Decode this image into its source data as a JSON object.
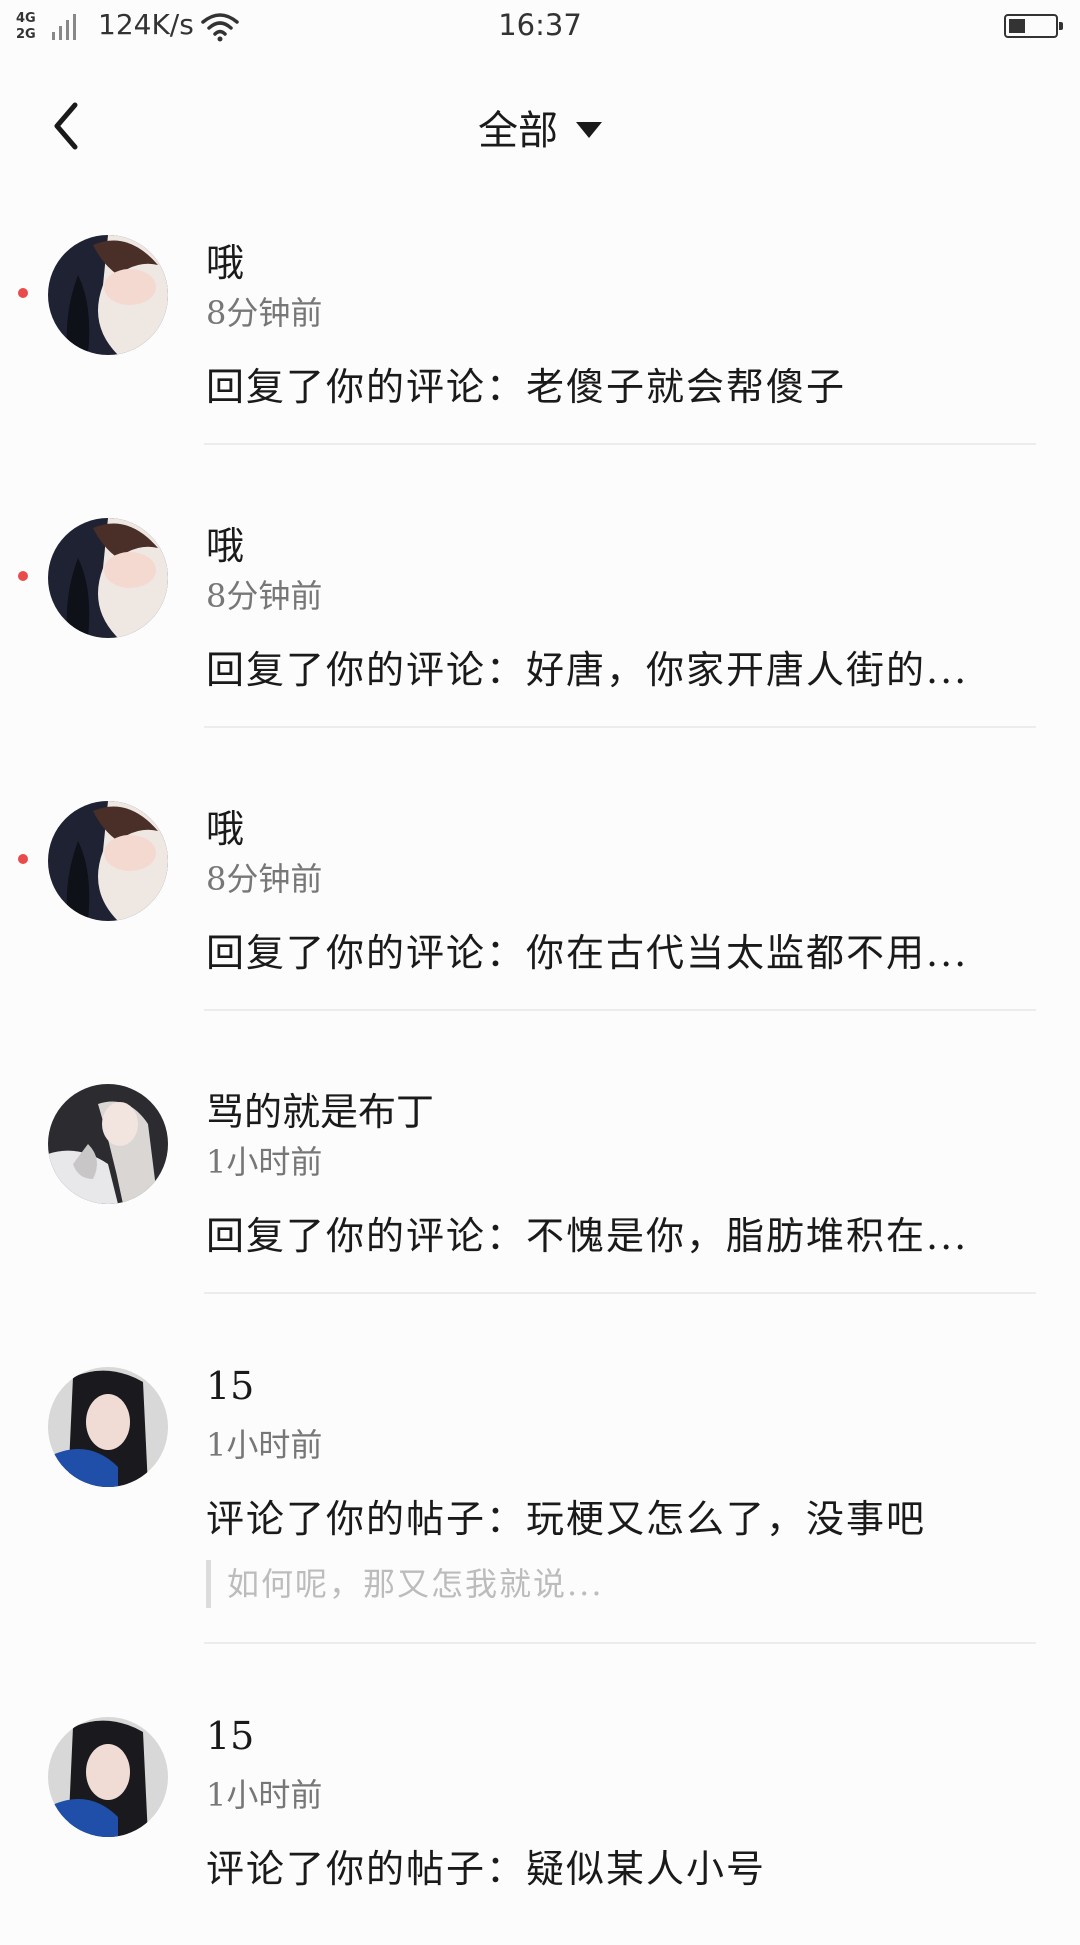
{
  "status_bar": {
    "network_top": "4G",
    "network_bottom": "2G",
    "speed": "124K/s",
    "time": "16:37"
  },
  "header": {
    "title": "全部"
  },
  "notifications": [
    {
      "user": "哦",
      "time": "8分钟前",
      "text": "回复了你的评论：老傻子就会帮傻子",
      "unread": true,
      "avatar": "avatar-girl-1"
    },
    {
      "user": "哦",
      "time": "8分钟前",
      "text": "回复了你的评论：好唐，你家开唐人街的...",
      "unread": true,
      "avatar": "avatar-girl-1"
    },
    {
      "user": "哦",
      "time": "8分钟前",
      "text": "回复了你的评论：你在古代当太监都不用...",
      "unread": true,
      "avatar": "avatar-girl-1"
    },
    {
      "user": "骂的就是布丁",
      "time": "1小时前",
      "text": "回复了你的评论：不愧是你，脂肪堆积在...",
      "unread": false,
      "avatar": "avatar-girl-2"
    },
    {
      "user": "15",
      "time": "1小时前",
      "text": "评论了你的帖子：玩梗又怎么了，没事吧",
      "quote": "如何呢，那又怎我就说...",
      "unread": false,
      "avatar": "avatar-girl-3"
    },
    {
      "user": "15",
      "time": "1小时前",
      "text": "评论了你的帖子：疑似某人小号",
      "unread": false,
      "avatar": "avatar-girl-3"
    }
  ]
}
